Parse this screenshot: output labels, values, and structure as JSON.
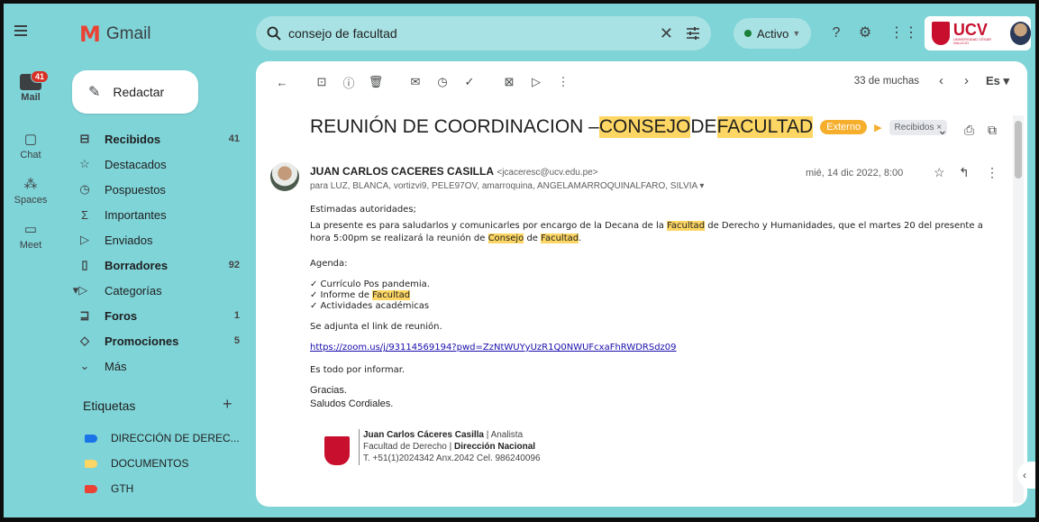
{
  "app": {
    "name": "Gmail"
  },
  "search": {
    "query": "consejo de facultad"
  },
  "status": {
    "label": "Activo"
  },
  "rail": {
    "mail_label": "Mail",
    "mail_badge": "41",
    "chat_label": "Chat",
    "spaces_label": "Spaces",
    "meet_label": "Meet"
  },
  "compose": {
    "label": "Redactar"
  },
  "nav": [
    {
      "label": "Recibidos",
      "count": "41",
      "icon": "inbox-icon",
      "bold": true
    },
    {
      "label": "Destacados",
      "count": "",
      "icon": "star-icon",
      "bold": false
    },
    {
      "label": "Pospuestos",
      "count": "",
      "icon": "clock-icon",
      "bold": false
    },
    {
      "label": "Importantes",
      "count": "",
      "icon": "important-icon",
      "bold": false
    },
    {
      "label": "Enviados",
      "count": "",
      "icon": "send-icon",
      "bold": false
    },
    {
      "label": "Borradores",
      "count": "92",
      "icon": "draft-icon",
      "bold": true
    },
    {
      "label": "Categorías",
      "count": "",
      "icon": "label-icon",
      "bold": false
    },
    {
      "label": "Foros",
      "count": "1",
      "icon": "forum-icon",
      "bold": true
    },
    {
      "label": "Promociones",
      "count": "5",
      "icon": "tag-icon",
      "bold": true
    },
    {
      "label": "Más",
      "count": "",
      "icon": "chevron-down-icon",
      "bold": false
    }
  ],
  "labels": {
    "heading": "Etiquetas",
    "items": [
      {
        "label": "DIRECCIÓN DE DEREC...",
        "color": "#1a73e8"
      },
      {
        "label": "DOCUMENTOS",
        "color": "#fdd663"
      },
      {
        "label": "GTH",
        "color": "#ea4335"
      }
    ]
  },
  "toolbar": {
    "counter": "33 de muchas",
    "lang": "Es"
  },
  "email": {
    "subject_1": "REUNIÓN DE COORDINACION – ",
    "subject_hl1": "CONSEJO",
    "subject_2": " DE ",
    "subject_hl2": "FACULTAD",
    "chip_external": "Externo",
    "chip_inbox": "Recibidos ×",
    "sender_name": "JUAN CARLOS CACERES CASILLA",
    "sender_email": "<jcaceresc@ucv.edu.pe>",
    "to": "para LUZ, BLANCA, vortizvi9, PELE97OV, amarroquina, ANGELAMARROQUINALFARO, SILVIA",
    "date": "mié, 14 dic 2022, 8:00",
    "greeting": "Estimadas autoridades;",
    "p1_a": "La presente es para saludarlos y comunicarles por encargo de la Decana de la ",
    "p1_hl": "Facultad",
    "p1_b": " de Derecho y Humanidades, que el martes 20 del presente a hora 5:00pm se realizará la reunión de ",
    "p1_hl2": "Consejo",
    "p1_c": " de ",
    "p1_hl3": "Facultad",
    "p1_d": ".",
    "agenda_label": "Agenda:",
    "agenda_1": "✓ Currículo Pos pandemia.",
    "agenda_2a": "✓ Informe de ",
    "agenda_2hl": "Facultad",
    "agenda_3": "✓ Actividades académicas",
    "attach": "Se adjunta el link de reunión.",
    "link": "https://zoom.us/j/93114569194?pwd=ZzNtWUYyUzR1Q0NWUFcxaFhRWDRSdz09",
    "closing": "Es todo por informar.",
    "thanks": "Gracias.",
    "regards": "Saludos Cordiales.",
    "sig_name": "Juan Carlos Cáceres Casilla",
    "sig_role": " | Analista",
    "sig_line2a": "Facultad de Derecho | ",
    "sig_line2b": "Dirección Nacional",
    "sig_line3": "T. +51(1)2024342 Anx.2042  Cel. 986240096"
  },
  "brand": {
    "ucv_text": "UCV",
    "ucv_sub": "UNIVERSIDAD CÉSAR VALLEJO",
    "accent": "#c8102e",
    "bg": "#7fd4d8"
  }
}
